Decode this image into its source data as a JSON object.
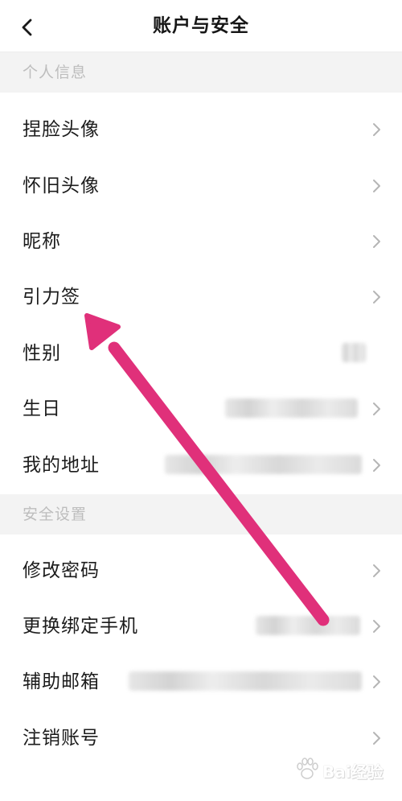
{
  "header": {
    "title": "账户与安全",
    "back_icon": "back-arrow-icon"
  },
  "sections": {
    "personal": {
      "title": "个人信息"
    },
    "security": {
      "title": "安全设置"
    }
  },
  "personal_items": [
    {
      "label": "捏脸头像",
      "value_blurred": false,
      "chevron": true
    },
    {
      "label": "怀旧头像",
      "value_blurred": false,
      "chevron": true
    },
    {
      "label": "昵称",
      "value_blurred": false,
      "chevron": true
    },
    {
      "label": "引力签",
      "value_blurred": false,
      "chevron": true
    },
    {
      "label": "性别",
      "value_blurred": true,
      "chevron": false
    },
    {
      "label": "生日",
      "value_blurred": true,
      "chevron": true
    },
    {
      "label": "我的地址",
      "value_blurred": true,
      "chevron": true
    }
  ],
  "security_items": [
    {
      "label": "修改密码",
      "value_blurred": false,
      "chevron": true
    },
    {
      "label": "更换绑定手机",
      "value_blurred": true,
      "chevron": true
    },
    {
      "label": "辅助邮箱",
      "value_blurred": true,
      "chevron": true
    },
    {
      "label": "注销账号",
      "value_blurred": false,
      "chevron": true
    }
  ],
  "annotation": {
    "type": "arrow",
    "color": "#e0307a",
    "points_to": "引力签"
  },
  "watermark": {
    "text": "Bai经验",
    "icon": "paw-icon"
  },
  "colors": {
    "section_bg": "#f3f3f3",
    "section_text": "#bdbdbd",
    "label_text": "#1c1c1c",
    "chevron": "#b5b5b5",
    "arrow": "#e0307a"
  }
}
